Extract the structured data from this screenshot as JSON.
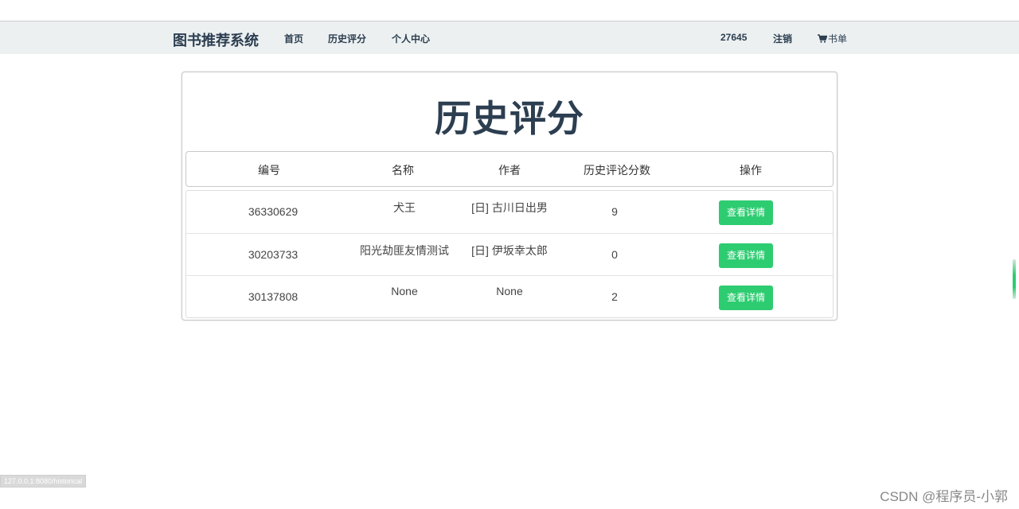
{
  "nav": {
    "brand": "图书推荐系统",
    "links": [
      "首页",
      "历史评分",
      "个人中心"
    ],
    "user_id": "27645",
    "logout": "注销",
    "cart_label": "书单"
  },
  "page": {
    "title": "历史评分"
  },
  "table": {
    "headers": [
      "编号",
      "名称",
      "作者",
      "历史评论分数",
      "操作"
    ],
    "rows": [
      {
        "id": "36330629",
        "name": "犬王",
        "author": "[日] 古川日出男",
        "score": "9",
        "action": "查看详情"
      },
      {
        "id": "30203733",
        "name": "阳光劫匪友情测试",
        "author": "[日] 伊坂幸太郎",
        "score": "0",
        "action": "查看详情"
      },
      {
        "id": "30137808",
        "name": "None",
        "author": "None",
        "score": "2",
        "action": "查看详情"
      }
    ]
  },
  "status_bar": {
    "url": "127.0.0.1:8080/historical"
  },
  "watermark": "CSDN @程序员-小郭",
  "colors": {
    "navbar_bg": "#ecf0f1",
    "brand_text": "#2c3e50",
    "button_bg": "#2ecc71"
  }
}
